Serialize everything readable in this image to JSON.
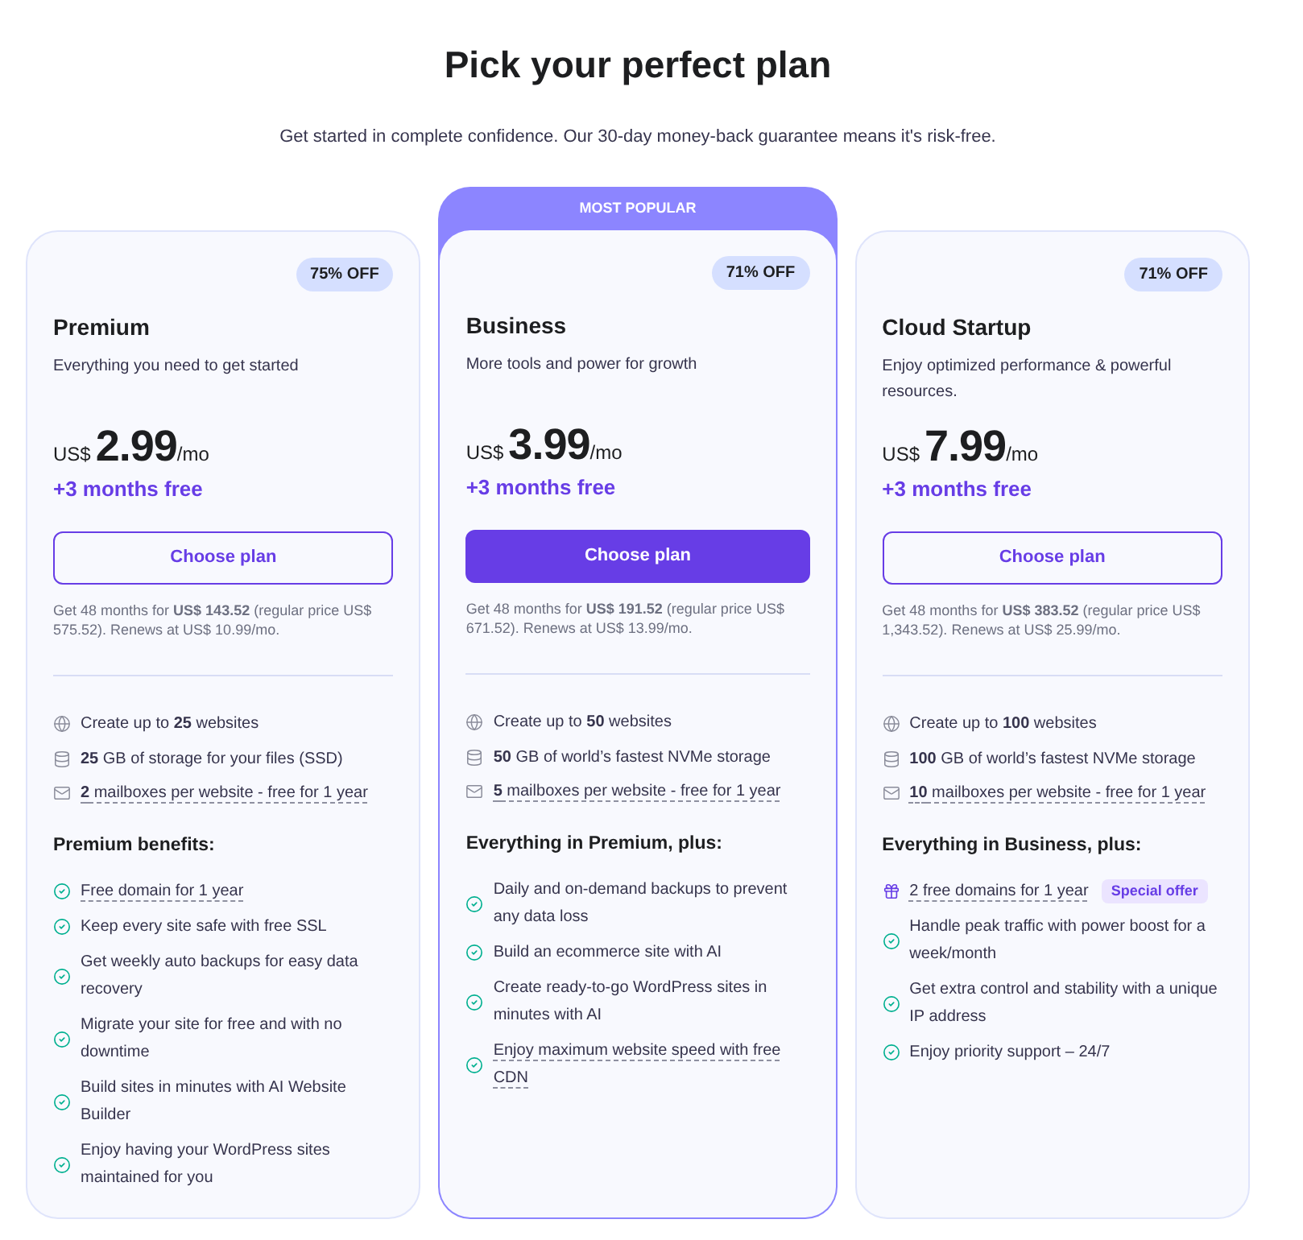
{
  "heading": {
    "title": "Pick your perfect plan",
    "subtitle": "Get started in complete confidence. Our 30-day money-back guarantee means it's risk-free."
  },
  "plans": [
    {
      "name": "Premium",
      "highlighted": false,
      "discount": "75% OFF",
      "description": "Everything you need to get started",
      "currency": "US$",
      "price": "2.99",
      "period": "/mo",
      "bonus": "+3 months free",
      "button": "Choose plan",
      "fine_print": "Get 48 months for **US$ 143.52** (regular price US$ 575.52). Renews at US$ 10.99/mo.",
      "features": [
        {
          "kind": "websites",
          "text": "Create up to **25** websites",
          "dashed": false
        },
        {
          "kind": "storage",
          "text": "**25** GB of storage for your files (SSD)",
          "dashed": false
        },
        {
          "kind": "email",
          "text": "**2** mailboxes per website - free for 1 year",
          "dashed": true
        }
      ],
      "benefits_heading": "Premium benefits:",
      "benefits": [
        {
          "kind": "check",
          "text": "Free domain for 1 year",
          "dashed": true
        },
        {
          "kind": "check",
          "text": "Keep every site safe with free SSL",
          "dashed": false
        },
        {
          "kind": "check",
          "text": "Get weekly auto backups for easy data recovery",
          "dashed": false
        },
        {
          "kind": "check",
          "text": "Migrate your site for free and with no downtime",
          "dashed": false
        },
        {
          "kind": "check",
          "text": "Build sites in minutes with AI Website Builder",
          "dashed": false
        },
        {
          "kind": "check",
          "text": "Enjoy having your WordPress sites maintained for you",
          "dashed": false
        }
      ]
    },
    {
      "banner": "MOST POPULAR",
      "name": "Business",
      "highlighted": true,
      "discount": "71% OFF",
      "description": "More tools and power for growth",
      "currency": "US$",
      "price": "3.99",
      "period": "/mo",
      "bonus": "+3 months free",
      "button": "Choose plan",
      "fine_print": "Get 48 months for **US$ 191.52** (regular price US$ 671.52). Renews at US$ 13.99/mo.",
      "features": [
        {
          "kind": "websites",
          "text": "Create up to **50** websites",
          "dashed": false
        },
        {
          "kind": "storage",
          "text": "**50** GB of world’s fastest NVMe storage",
          "dashed": false
        },
        {
          "kind": "email",
          "text": "**5** mailboxes per website - free for 1 year",
          "dashed": true
        }
      ],
      "benefits_heading": "Everything in Premium, plus:",
      "benefits": [
        {
          "kind": "check",
          "text": "Daily and on-demand backups to prevent any data loss",
          "dashed": false
        },
        {
          "kind": "check",
          "text": "Build an ecommerce site with AI",
          "dashed": false
        },
        {
          "kind": "check",
          "text": "Create ready-to-go WordPress sites in minutes with AI",
          "dashed": false
        },
        {
          "kind": "check",
          "text": "Enjoy maximum website speed with free CDN",
          "dashed": true
        }
      ]
    },
    {
      "name": "Cloud Startup",
      "highlighted": false,
      "discount": "71% OFF",
      "description": "Enjoy optimized performance & powerful resources.",
      "currency": "US$",
      "price": "7.99",
      "period": "/mo",
      "bonus": "+3 months free",
      "button": "Choose plan",
      "fine_print": "Get 48 months for **US$ 383.52** (regular price US$ 1,343.52). Renews at US$ 25.99/mo.",
      "features": [
        {
          "kind": "websites",
          "text": "Create up to **100** websites",
          "dashed": false
        },
        {
          "kind": "storage",
          "text": "**100** GB of world’s fastest NVMe storage",
          "dashed": false
        },
        {
          "kind": "email",
          "text": "**10** mailboxes per website - free for 1 year",
          "dashed": true
        }
      ],
      "benefits_heading": "Everything in Business, plus:",
      "benefits": [
        {
          "kind": "gift",
          "text": "2 free domains for 1 year",
          "dashed": true,
          "badge": "Special offer"
        },
        {
          "kind": "check",
          "text": "Handle peak traffic with power boost for a week/month",
          "dashed": false
        },
        {
          "kind": "check",
          "text": "Get extra control and stability with a unique IP address",
          "dashed": false
        },
        {
          "kind": "check",
          "text": "Enjoy priority support – 24/7",
          "dashed": false
        }
      ]
    }
  ]
}
